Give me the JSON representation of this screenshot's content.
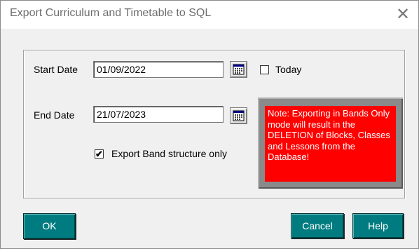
{
  "window": {
    "title": "Export Curriculum and Timetable to SQL",
    "close_glyph": "✕"
  },
  "form": {
    "start_date_label": "Start Date",
    "start_date_value": "01/09/2022",
    "today_label": "Today",
    "today_checked": false,
    "end_date_label": "End Date",
    "end_date_value": "21/07/2023",
    "export_band_label": "Export Band structure only",
    "export_band_checked": true,
    "check_glyph": "✔"
  },
  "note": {
    "text": "Note: Exporting in Bands Only mode will  result in the DELETION of Blocks, Classes and Lessons from the Database!"
  },
  "buttons": {
    "ok": "OK",
    "cancel": "Cancel",
    "help": "Help"
  },
  "colors": {
    "button": "#007c80",
    "note_background": "#ff0000",
    "note_frame": "#8a8a8a",
    "note_text": "#ffffff"
  },
  "icons": {
    "calendar": "calendar-icon",
    "close": "close-icon"
  }
}
